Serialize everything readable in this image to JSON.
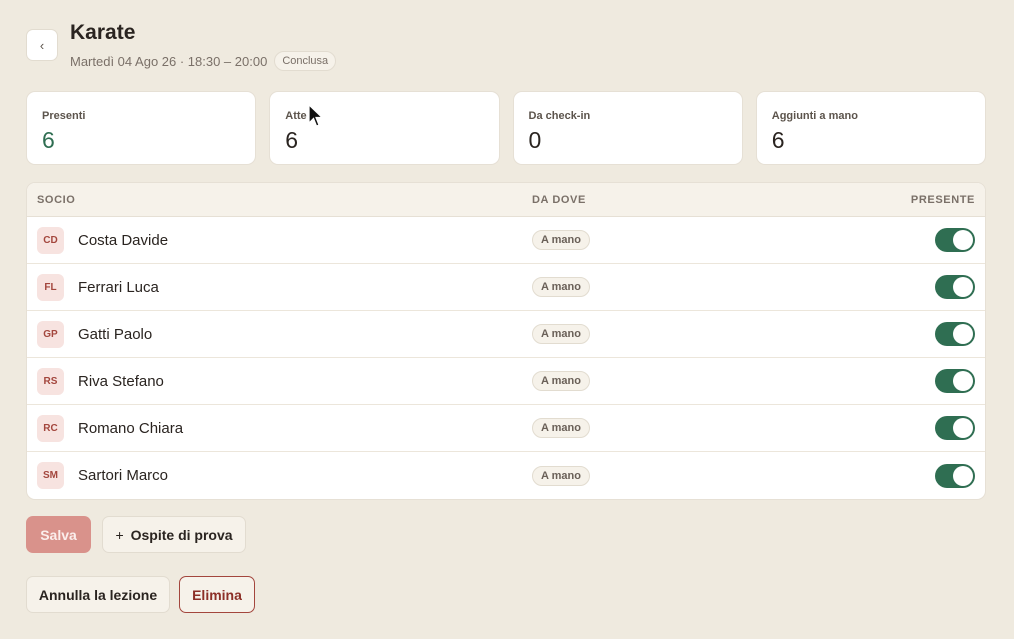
{
  "header": {
    "back_icon": "chevron-left-icon",
    "title": "Karate",
    "subtitle": "Martedì 04 Ago 26 · 18:30 – 20:00",
    "status": "Conclusa"
  },
  "stats": [
    {
      "label": "Presenti",
      "value": "6"
    },
    {
      "label": "Atte",
      "value": "6"
    },
    {
      "label": "Da check-in",
      "value": "0"
    },
    {
      "label": "Aggiunti a mano",
      "value": "6"
    }
  ],
  "table": {
    "headers": {
      "member": "SOCIO",
      "source": "DA DOVE",
      "present": "PRESENTE"
    },
    "rows": [
      {
        "initials": "CD",
        "name": "Costa Davide",
        "source": "A mano",
        "present": true
      },
      {
        "initials": "FL",
        "name": "Ferrari Luca",
        "source": "A mano",
        "present": true
      },
      {
        "initials": "GP",
        "name": "Gatti Paolo",
        "source": "A mano",
        "present": true
      },
      {
        "initials": "RS",
        "name": "Riva Stefano",
        "source": "A mano",
        "present": true
      },
      {
        "initials": "RC",
        "name": "Romano Chiara",
        "source": "A mano",
        "present": true
      },
      {
        "initials": "SM",
        "name": "Sartori Marco",
        "source": "A mano",
        "present": true
      }
    ]
  },
  "actions": {
    "save": "Salva",
    "guest_plus": "+",
    "guest": "Ospite di prova",
    "cancel": "Annulla la lezione",
    "delete": "Elimina"
  },
  "colors": {
    "accent_green": "#2f6e52",
    "danger": "#a3463d",
    "background": "#efeadf"
  }
}
